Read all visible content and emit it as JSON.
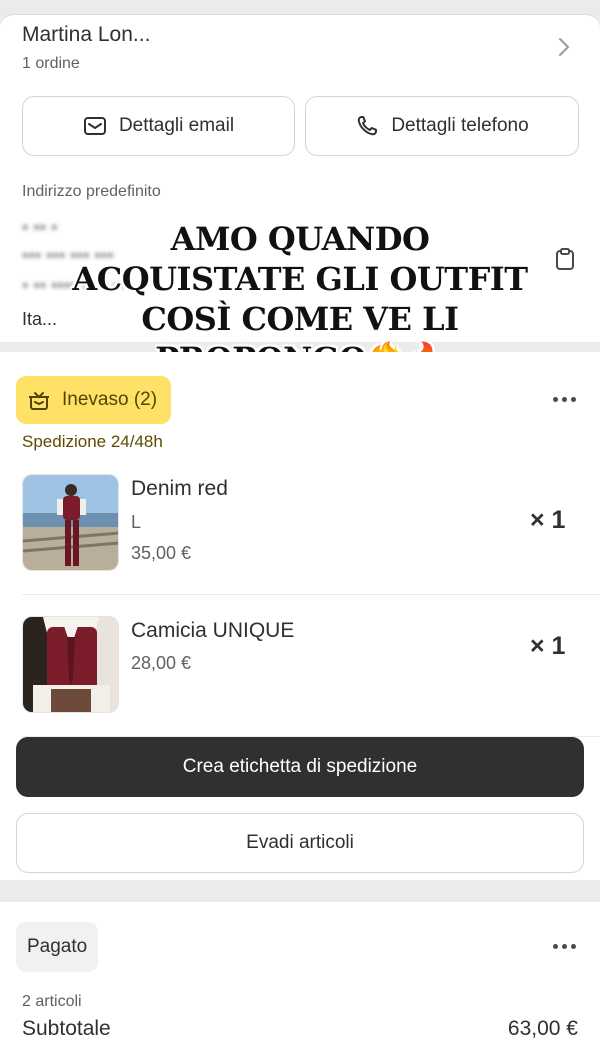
{
  "customer": {
    "name": "Martina Lon...",
    "orders": "1 ordine",
    "email_button": "Dettagli email",
    "phone_button": "Dettagli telefono",
    "address_label": "Indirizzo predefinito",
    "address_country": "Ita..."
  },
  "overlay_text": "AMO QUANDO ACQUISTATE GLI OUTFIT COSÌ COME VE LI PROPONGO❤️‍🔥🔥",
  "fulfillment": {
    "status_badge": "Inevaso (2)",
    "shipping": "Spedizione 24/48h",
    "items": [
      {
        "title": "Denim red",
        "variant": "L",
        "price": "35,00 €",
        "qty": "× 1"
      },
      {
        "title": "Camicia UNIQUE",
        "price": "28,00 €",
        "qty": "× 1"
      }
    ],
    "create_label_button": "Crea etichetta di spedizione",
    "fulfill_button": "Evadi articoli"
  },
  "payment": {
    "status_badge": "Pagato",
    "items_count": "2 articoli",
    "subtotal_label": "Subtotale",
    "subtotal_value": "63,00 €"
  }
}
